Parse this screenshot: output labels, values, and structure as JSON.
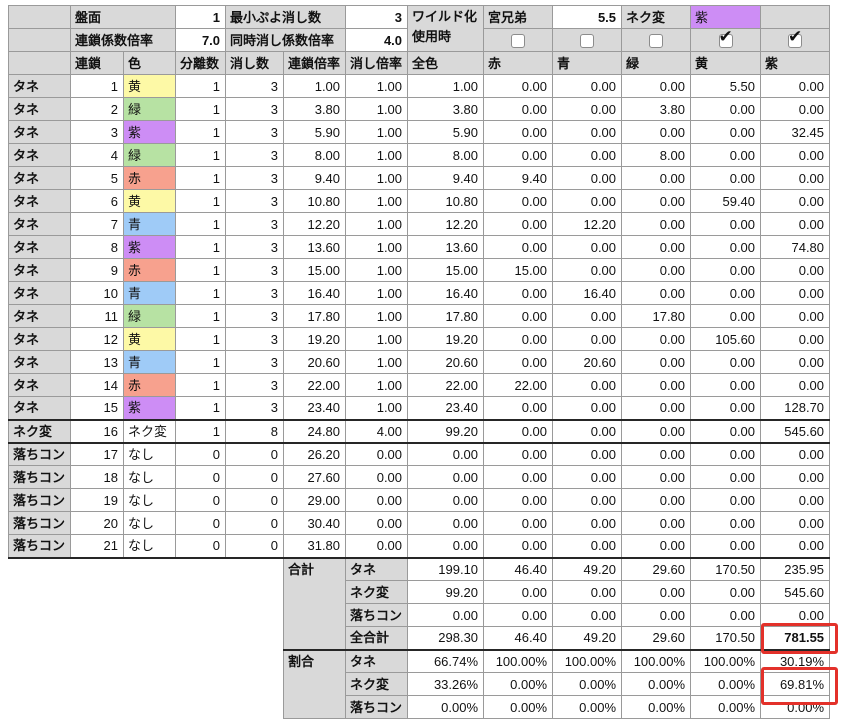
{
  "settings": {
    "board_label": "盤面",
    "board_value": "1",
    "min_clear_label": "最小ぷよ消し数",
    "min_clear_value": "3",
    "chain_coef_label": "連鎖係数倍率",
    "chain_coef_value": "7.0",
    "simul_coef_label": "同時消し係数倍率",
    "simul_coef_value": "4.0",
    "wild_label_line1": "ワイルド化",
    "wild_label_line2": "使用時",
    "miya_label": "宮兄弟",
    "miya_value": "5.5",
    "neku_label": "ネク変",
    "neku_color": "紫",
    "wild_checkboxes": [
      false,
      false,
      false,
      true,
      true
    ],
    "check_icon": "check-icon"
  },
  "columns": [
    "連鎖",
    "色",
    "分離数",
    "消し数",
    "連鎖倍率",
    "消し倍率",
    "全色",
    "赤",
    "青",
    "緑",
    "黄",
    "紫"
  ],
  "rows": [
    {
      "cells": [
        "タネ",
        "1",
        "黄",
        "1",
        "3",
        "1.00",
        "1.00",
        "1.00",
        "0.00",
        "0.00",
        "0.00",
        "5.50",
        "0.00"
      ]
    },
    {
      "cells": [
        "タネ",
        "2",
        "緑",
        "1",
        "3",
        "3.80",
        "1.00",
        "3.80",
        "0.00",
        "0.00",
        "3.80",
        "0.00",
        "0.00"
      ]
    },
    {
      "cells": [
        "タネ",
        "3",
        "紫",
        "1",
        "3",
        "5.90",
        "1.00",
        "5.90",
        "0.00",
        "0.00",
        "0.00",
        "0.00",
        "32.45"
      ]
    },
    {
      "cells": [
        "タネ",
        "4",
        "緑",
        "1",
        "3",
        "8.00",
        "1.00",
        "8.00",
        "0.00",
        "0.00",
        "8.00",
        "0.00",
        "0.00"
      ]
    },
    {
      "cells": [
        "タネ",
        "5",
        "赤",
        "1",
        "3",
        "9.40",
        "1.00",
        "9.40",
        "9.40",
        "0.00",
        "0.00",
        "0.00",
        "0.00"
      ]
    },
    {
      "cells": [
        "タネ",
        "6",
        "黄",
        "1",
        "3",
        "10.80",
        "1.00",
        "10.80",
        "0.00",
        "0.00",
        "0.00",
        "59.40",
        "0.00"
      ]
    },
    {
      "cells": [
        "タネ",
        "7",
        "青",
        "1",
        "3",
        "12.20",
        "1.00",
        "12.20",
        "0.00",
        "12.20",
        "0.00",
        "0.00",
        "0.00"
      ]
    },
    {
      "cells": [
        "タネ",
        "8",
        "紫",
        "1",
        "3",
        "13.60",
        "1.00",
        "13.60",
        "0.00",
        "0.00",
        "0.00",
        "0.00",
        "74.80"
      ]
    },
    {
      "cells": [
        "タネ",
        "9",
        "赤",
        "1",
        "3",
        "15.00",
        "1.00",
        "15.00",
        "15.00",
        "0.00",
        "0.00",
        "0.00",
        "0.00"
      ]
    },
    {
      "cells": [
        "タネ",
        "10",
        "青",
        "1",
        "3",
        "16.40",
        "1.00",
        "16.40",
        "0.00",
        "16.40",
        "0.00",
        "0.00",
        "0.00"
      ]
    },
    {
      "cells": [
        "タネ",
        "11",
        "緑",
        "1",
        "3",
        "17.80",
        "1.00",
        "17.80",
        "0.00",
        "0.00",
        "17.80",
        "0.00",
        "0.00"
      ]
    },
    {
      "cells": [
        "タネ",
        "12",
        "黄",
        "1",
        "3",
        "19.20",
        "1.00",
        "19.20",
        "0.00",
        "0.00",
        "0.00",
        "105.60",
        "0.00"
      ]
    },
    {
      "cells": [
        "タネ",
        "13",
        "青",
        "1",
        "3",
        "20.60",
        "1.00",
        "20.60",
        "0.00",
        "20.60",
        "0.00",
        "0.00",
        "0.00"
      ]
    },
    {
      "cells": [
        "タネ",
        "14",
        "赤",
        "1",
        "3",
        "22.00",
        "1.00",
        "22.00",
        "22.00",
        "0.00",
        "0.00",
        "0.00",
        "0.00"
      ]
    },
    {
      "cells": [
        "タネ",
        "15",
        "紫",
        "1",
        "3",
        "23.40",
        "1.00",
        "23.40",
        "0.00",
        "0.00",
        "0.00",
        "0.00",
        "128.70"
      ]
    },
    {
      "cells": [
        "ネク変",
        "16",
        "ネク変",
        "1",
        "8",
        "24.80",
        "4.00",
        "99.20",
        "0.00",
        "0.00",
        "0.00",
        "0.00",
        "545.60"
      ]
    },
    {
      "cells": [
        "落ちコン",
        "17",
        "なし",
        "0",
        "0",
        "26.20",
        "0.00",
        "0.00",
        "0.00",
        "0.00",
        "0.00",
        "0.00",
        "0.00"
      ]
    },
    {
      "cells": [
        "落ちコン",
        "18",
        "なし",
        "0",
        "0",
        "27.60",
        "0.00",
        "0.00",
        "0.00",
        "0.00",
        "0.00",
        "0.00",
        "0.00"
      ]
    },
    {
      "cells": [
        "落ちコン",
        "19",
        "なし",
        "0",
        "0",
        "29.00",
        "0.00",
        "0.00",
        "0.00",
        "0.00",
        "0.00",
        "0.00",
        "0.00"
      ]
    },
    {
      "cells": [
        "落ちコン",
        "20",
        "なし",
        "0",
        "0",
        "30.40",
        "0.00",
        "0.00",
        "0.00",
        "0.00",
        "0.00",
        "0.00",
        "0.00"
      ]
    },
    {
      "cells": [
        "落ちコン",
        "21",
        "なし",
        "0",
        "0",
        "31.80",
        "0.00",
        "0.00",
        "0.00",
        "0.00",
        "0.00",
        "0.00",
        "0.00"
      ]
    }
  ],
  "summary": {
    "total": {
      "label": "合計",
      "rows": [
        {
          "label": "タネ",
          "values": [
            "199.10",
            "46.40",
            "49.20",
            "29.60",
            "170.50",
            "235.95"
          ]
        },
        {
          "label": "ネク変",
          "values": [
            "99.20",
            "0.00",
            "0.00",
            "0.00",
            "0.00",
            "545.60"
          ]
        },
        {
          "label": "落ちコン",
          "values": [
            "0.00",
            "0.00",
            "0.00",
            "0.00",
            "0.00",
            "0.00"
          ]
        },
        {
          "label": "全合計",
          "values": [
            "298.30",
            "46.40",
            "49.20",
            "29.60",
            "170.50",
            "781.55"
          ]
        }
      ]
    },
    "ratio": {
      "label": "割合",
      "rows": [
        {
          "label": "タネ",
          "values": [
            "66.74%",
            "100.00%",
            "100.00%",
            "100.00%",
            "100.00%",
            "30.19%"
          ]
        },
        {
          "label": "ネク変",
          "values": [
            "33.26%",
            "0.00%",
            "0.00%",
            "0.00%",
            "0.00%",
            "69.81%"
          ]
        },
        {
          "label": "落ちコン",
          "values": [
            "0.00%",
            "0.00%",
            "0.00%",
            "0.00%",
            "0.00%",
            "0.00%"
          ]
        }
      ]
    }
  },
  "color_map": {
    "黄": "#fdf9a6",
    "緑": "#b7e2a3",
    "紫": "#cd8df5",
    "赤": "#f7a18e",
    "青": "#9fcbf7"
  },
  "theme": {
    "highlight": "#e3312a"
  }
}
